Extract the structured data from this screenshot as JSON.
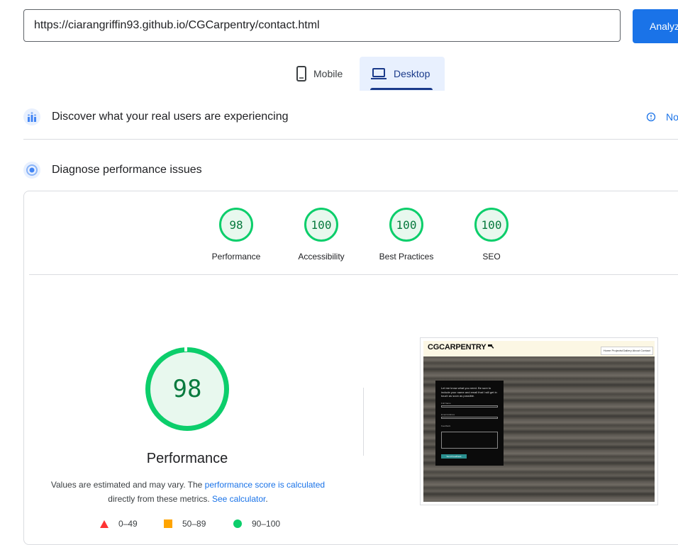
{
  "url_bar": {
    "value": "https://ciarangriffin93.github.io/CGCarpentry/contact.html",
    "analyze_label": "Analyze"
  },
  "device_tabs": {
    "mobile_label": "Mobile",
    "desktop_label": "Desktop",
    "selected": "Desktop"
  },
  "sections": {
    "real_users_title": "Discover what your real users are experiencing",
    "no_data_label": "No",
    "diagnose_title": "Diagnose performance issues"
  },
  "scores": [
    {
      "label": "Performance",
      "value": "98"
    },
    {
      "label": "Accessibility",
      "value": "100"
    },
    {
      "label": "Best Practices",
      "value": "100"
    },
    {
      "label": "SEO",
      "value": "100"
    }
  ],
  "performance": {
    "score": "98",
    "title": "Performance",
    "disclaimer_prefix": "Values are estimated and may vary. The ",
    "disclaimer_link": "performance score is calculated",
    "disclaimer_middle": "directly from these metrics. ",
    "calculator_link": "See calculator",
    "disclaimer_suffix": "."
  },
  "legend": [
    {
      "range": "0–49",
      "color": "#ff3333"
    },
    {
      "range": "50–89",
      "color": "#ffa400"
    },
    {
      "range": "90–100",
      "color": "#0cce6b"
    }
  ],
  "thumbnail": {
    "logo": "CGCARPENTRY",
    "nav": "Home  Projects/Gallery  About  Contact",
    "intro": "Let me know what you need. Be sure to include your name and email that I will get in touch as soon as possible.",
    "field1": "Full Name",
    "field2": "Email Address",
    "field3": "Feedback",
    "button": "Send Feedback"
  },
  "colors": {
    "accent": "#1a73e8",
    "pass": "#0cce6b",
    "selected_tab": "#e8f0fe"
  }
}
